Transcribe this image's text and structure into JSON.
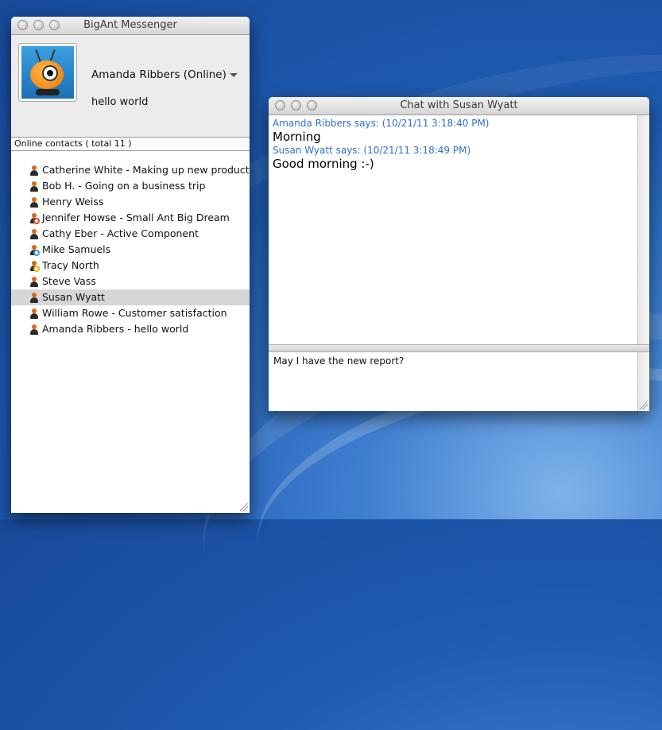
{
  "main_window": {
    "title": "BigAnt Messenger",
    "user_name": "Amanda Ribbers (Online)",
    "status_message": "hello world",
    "contacts_header": "Online contacts ( total 11 )",
    "contacts": [
      {
        "name": "Catherine  White - Making up new product",
        "status": "online"
      },
      {
        "name": "Bob H. - Going on a business trip",
        "status": "online"
      },
      {
        "name": "Henry Weiss",
        "status": "online"
      },
      {
        "name": "Jennifer Howse - Small Ant Big Dream",
        "status": "busy"
      },
      {
        "name": "Cathy Eber - Active Component",
        "status": "online"
      },
      {
        "name": "Mike  Samuels",
        "status": "away"
      },
      {
        "name": "Tracy North",
        "status": "idle"
      },
      {
        "name": "Steve Vass",
        "status": "online"
      },
      {
        "name": "Susan Wyatt",
        "status": "online",
        "selected": true
      },
      {
        "name": "William Rowe - Customer satisfaction",
        "status": "online"
      },
      {
        "name": "Amanda Ribbers - hello world",
        "status": "online"
      }
    ]
  },
  "chat_window": {
    "title": "Chat with Susan Wyatt",
    "messages": [
      {
        "header": "Amanda Ribbers says: (10/21/11 3:18:40 PM)",
        "text": "Morning"
      },
      {
        "header": "Susan Wyatt says: (10/21/11 3:18:49 PM)",
        "text": "Good morning :-)"
      }
    ],
    "input_text": "May I have the new report?"
  },
  "colors": {
    "says_header": "#2f6fd6",
    "selected_row": "#d6d6d6",
    "status_busy": "#e04a2a",
    "status_away": "#3a9ad9",
    "status_idle": "#f0b400"
  }
}
